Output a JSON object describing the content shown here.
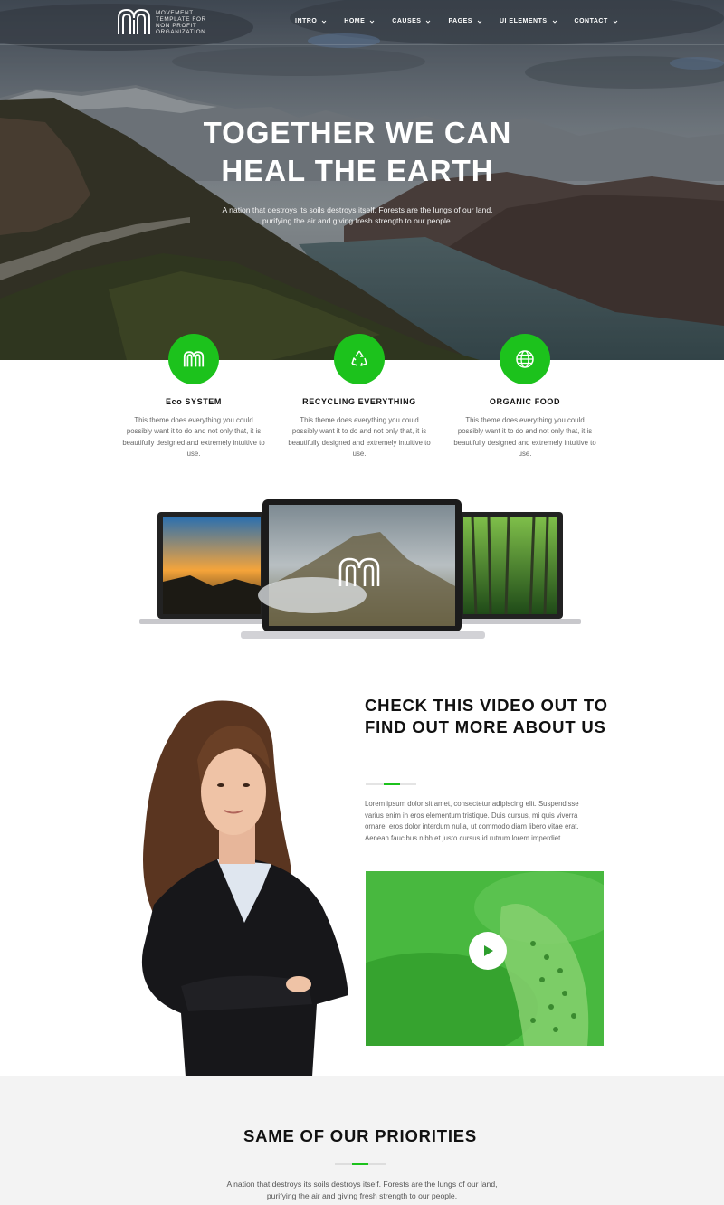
{
  "header": {
    "logo_text": "MOVEMENT TEMPLATE FOR NON PROFIT ORGANIZATION",
    "nav": [
      {
        "label": "INTRO"
      },
      {
        "label": "HOME"
      },
      {
        "label": "CAUSES"
      },
      {
        "label": "PAGES"
      },
      {
        "label": "UI ELEMENTS"
      },
      {
        "label": "CONTACT"
      }
    ]
  },
  "hero": {
    "title_line1": "TOGETHER WE CAN",
    "title_line2": "HEAL THE EARTH",
    "subtitle": "A nation that destroys its soils destroys itself. Forests are the lungs of our land, purifying the air and giving fresh strength to our people."
  },
  "features": [
    {
      "icon": "movement-logo-icon",
      "title": "Eco SYSTEM",
      "text": "This theme does everything you could possibly want it to do and not only that, it is beautifully designed and extremely intuitive to use."
    },
    {
      "icon": "recycle-icon",
      "title": "RECYCLING EVERYTHING",
      "text": "This theme does everything you could possibly want it to do and not only that, it is beautifully designed and extremely intuitive to use."
    },
    {
      "icon": "globe-icon",
      "title": "ORGANIC FOOD",
      "text": "This theme does everything you could possibly want it to do and not only that, it is beautifully designed and extremely intuitive to use."
    }
  ],
  "video_section": {
    "title": "CHECK THIS VIDEO OUT TO FIND OUT MORE ABOUT US",
    "text": "Lorem ipsum dolor sit amet, consectetur adipiscing elit. Suspendisse varius enim in eros elementum tristique. Duis cursus, mi quis viverra ornare, eros dolor interdum nulla, ut commodo diam libero vitae erat. Aenean faucibus nibh et justo cursus id rutrum lorem imperdiet."
  },
  "priorities": {
    "title": "SAME OF OUR PRIORITIES",
    "text": "A nation that destroys its soils destroys itself. Forests are the lungs of our land, purifying the air and giving fresh strength to our people."
  },
  "colors": {
    "accent": "#1cc21c",
    "video_overlay": "#3fb53a",
    "section_bg": "#f3f3f3"
  }
}
